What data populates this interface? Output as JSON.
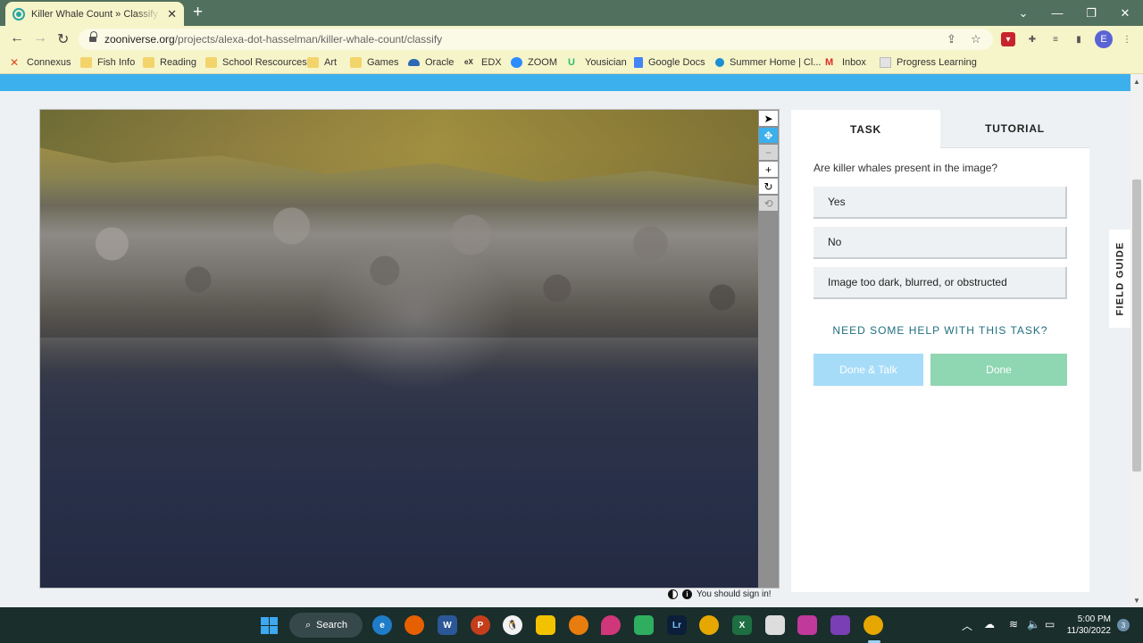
{
  "browser": {
    "tab_title": "Killer Whale Count » Classify — Zooniverse",
    "new_tab": "+",
    "url_host": "zooniverse.org",
    "url_path": "/projects/alexa-dot-hasselman/killer-whale-count/classify",
    "profile_initial": "E",
    "window_controls": [
      "⌄",
      "—",
      "❐",
      "✕"
    ]
  },
  "bookmarks": [
    {
      "label": "Connexus",
      "icon": "connexus-icon",
      "color": "#d9481c"
    },
    {
      "label": "Fish Info",
      "icon": "folder-icon",
      "color": "#f3d46b"
    },
    {
      "label": "Reading",
      "icon": "folder-icon",
      "color": "#f3d46b"
    },
    {
      "label": "School Rescources",
      "icon": "folder-icon",
      "color": "#f3d46b"
    },
    {
      "label": "Art",
      "icon": "folder-icon",
      "color": "#f3d46b"
    },
    {
      "label": "Games",
      "icon": "folder-icon",
      "color": "#f3d46b"
    },
    {
      "label": "Oracle",
      "icon": "cloud-icon",
      "color": "#2d6ab3"
    },
    {
      "label": "EDX",
      "icon": "edx-icon",
      "color": "#333333"
    },
    {
      "label": "ZOOM",
      "icon": "zoom-icon",
      "color": "#2d8cff"
    },
    {
      "label": "Yousician",
      "icon": "yousician-icon",
      "color": "#27c26b"
    },
    {
      "label": "Google Docs",
      "icon": "docs-icon",
      "color": "#4285f4"
    },
    {
      "label": "Summer Home | Cl...",
      "icon": "summer-icon",
      "color": "#1b8fd1"
    },
    {
      "label": "Inbox",
      "icon": "gmail-icon",
      "color": "#d93025"
    },
    {
      "label": "Progress Learning",
      "icon": "progress-icon",
      "color": "#cccccc"
    }
  ],
  "viewer": {
    "tools": [
      "pointer-icon",
      "move-icon",
      "zoom-out-icon",
      "zoom-in-icon",
      "rotate-icon",
      "reset-icon"
    ],
    "tool_glyphs": [
      "➤",
      "✥",
      "−",
      "+",
      "↻",
      "⟲"
    ],
    "signin_text": "You should sign in!"
  },
  "panel": {
    "tabs": [
      "TASK",
      "TUTORIAL"
    ],
    "question": "Are killer whales present in the image?",
    "answers": [
      "Yes",
      "No",
      "Image too dark, blurred, or obstructed"
    ],
    "help_link": "NEED SOME HELP WITH THIS TASK?",
    "done_talk": "Done & Talk",
    "done": "Done"
  },
  "field_guide": "FIELD GUIDE",
  "taskbar": {
    "search_label": "Search",
    "time": "5:00 PM",
    "date": "11/30/2022",
    "notifications": "3"
  }
}
